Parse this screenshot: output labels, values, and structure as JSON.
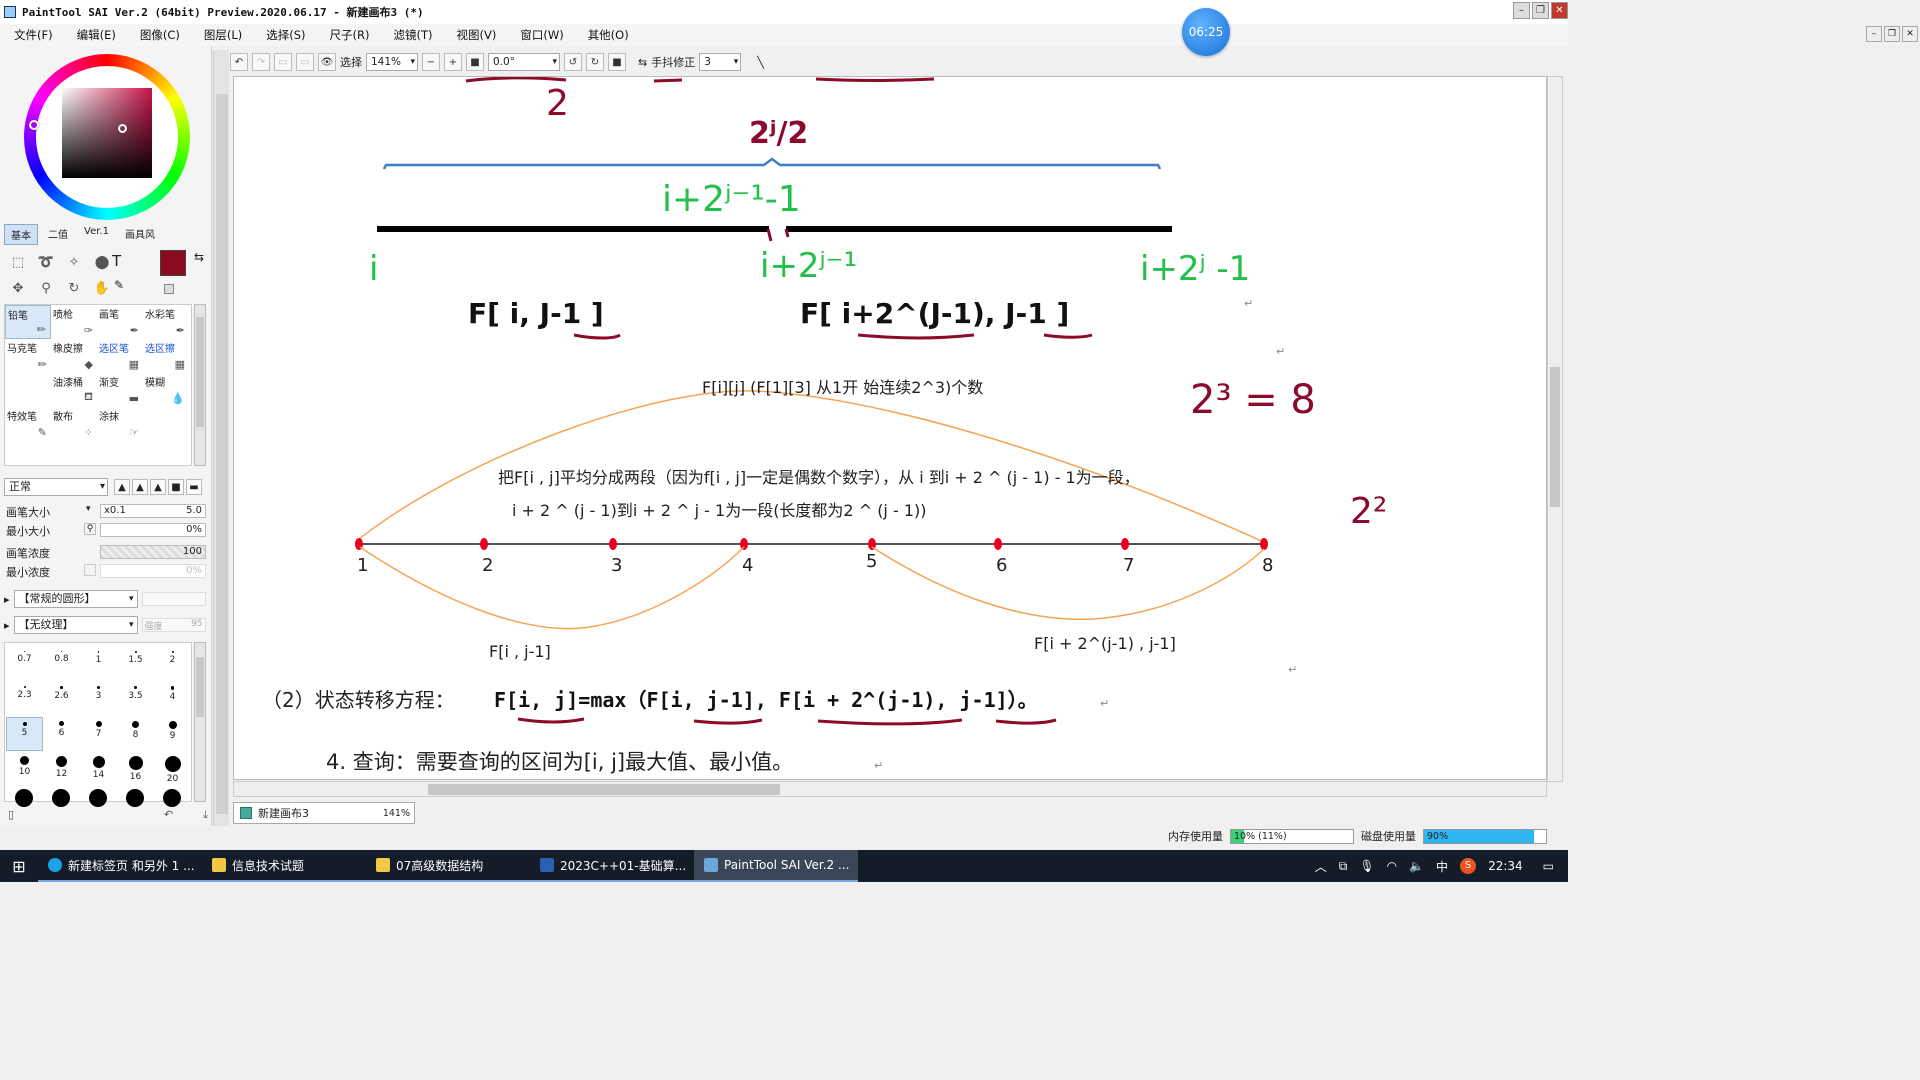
{
  "window": {
    "title": "PaintTool SAI Ver.2 (64bit) Preview.2020.06.17 - 新建画布3 (*)",
    "timer": "06:25"
  },
  "menu": [
    "文件(F)",
    "编辑(E)",
    "图像(C)",
    "图层(L)",
    "选择(S)",
    "尺子(R)",
    "滤镜(T)",
    "视图(V)",
    "窗口(W)",
    "其他(O)"
  ],
  "toolbar": {
    "select_label": "选择",
    "zoom": "141%",
    "angle": "0.0°",
    "stabilizer_label": "手抖修正",
    "stabilizer_value": "3"
  },
  "panel_tabs": [
    "基本",
    "二值",
    "Ver.1",
    "画具风"
  ],
  "brushes": [
    {
      "label": "铅笔",
      "blue": false
    },
    {
      "label": "喷枪",
      "blue": false
    },
    {
      "label": "画笔",
      "blue": false
    },
    {
      "label": "水彩笔",
      "blue": false
    },
    {
      "label": "马克笔",
      "blue": false
    },
    {
      "label": "橡皮擦",
      "blue": false
    },
    {
      "label": "选区笔",
      "blue": true
    },
    {
      "label": "选区擦",
      "blue": true
    },
    {
      "label": "",
      "blue": false
    },
    {
      "label": "油漆桶",
      "blue": false
    },
    {
      "label": "渐变",
      "blue": false
    },
    {
      "label": "模糊",
      "blue": false
    },
    {
      "label": "特效笔",
      "blue": false
    },
    {
      "label": "散布",
      "blue": false
    },
    {
      "label": "涂抹",
      "blue": false
    }
  ],
  "blend_mode": "正常",
  "params": {
    "brush_size_label": "画笔大小",
    "brush_size_mult": "x0.1",
    "brush_size_value": "5.0",
    "min_size_label": "最小大小",
    "min_size_value": "0%",
    "density_label": "画笔浓度",
    "density_value": "100",
    "min_density_label": "最小浓度",
    "min_density_value": "0%"
  },
  "shape_combo": "【常规的圆形】",
  "texture_combo": "【无纹理】",
  "texture_strength": "强度",
  "texture_strength_value": "95",
  "size_presets": [
    "0.7",
    "0.8",
    "1",
    "1.5",
    "2",
    "2.3",
    "2.6",
    "3",
    "3.5",
    "4",
    "5",
    "6",
    "7",
    "8",
    "9",
    "10",
    "12",
    "14",
    "16",
    "20"
  ],
  "selected_size": "5",
  "canvas_tab": {
    "name": "新建画布3",
    "zoom": "141%"
  },
  "status": {
    "memory_label": "内存使用量",
    "memory_value": "10% (11%)",
    "memory_fraction": 0.11,
    "disk_label": "磁盘使用量",
    "disk_value": "90%",
    "disk_fraction": 0.9
  },
  "canvas": {
    "top_number": "2",
    "header_exp": "2ʲ/2",
    "green_mid": "i+2ʲ⁻¹-1",
    "green_left": "i",
    "green_center": "i+2ʲ⁻¹",
    "green_right": "i+2ʲ -1",
    "f_left": "F[ i, J-1 ]",
    "f_right": "F[ i+2^(J-1), J-1 ]",
    "def_text": "F[i][j]  (F[1][3] 从1开 始连续2^3)个数",
    "note_23": "2³ = 8",
    "note_22": "2²",
    "explain1": "把F[i , j]平均分成两段（因为f[i , j]一定是偶数个数字），从 i 到i + 2 ^ (j - 1) - 1为一段，",
    "explain2": "i + 2 ^ (j - 1)到i + 2 ^ j - 1为一段(长度都为2 ^ (j - 1))",
    "points": [
      "1",
      "2",
      "3",
      "4",
      "5",
      "6",
      "7",
      "8"
    ],
    "label_left": "F[i , j-1]",
    "label_right": "F[i + 2^(j-1) , j-1]",
    "transition_prefix": "（2）状态转移方程：",
    "transition_formula": "F[i, j]=max（F[i, j-1], F[i + 2^(j-1), j-1]）。",
    "query_text": "4. 查询：需要查询的区间为[i, j]最大值、最小值。"
  },
  "taskbar": {
    "tasks": [
      {
        "label": "新建标签页 和另外 1 ...",
        "color": "#1aa3e8"
      },
      {
        "label": "信息技术试题",
        "color": "#f2c744"
      },
      {
        "label": "07高级数据结构",
        "color": "#f2c744"
      },
      {
        "label": "2023C++01-基础算...",
        "color": "#2b5fb4"
      },
      {
        "label": "PaintTool SAI Ver.2 ...",
        "color": "#6aa6d8"
      }
    ],
    "ime": "中",
    "time": "22:34"
  },
  "colors": {
    "green": "#22c04a",
    "maroon": "#8c0a2c",
    "orange_curve": "#f5a455",
    "blue_brace": "#3d7fc4",
    "point_red": "#e8001c",
    "brush_color": "#8b0a1e"
  }
}
